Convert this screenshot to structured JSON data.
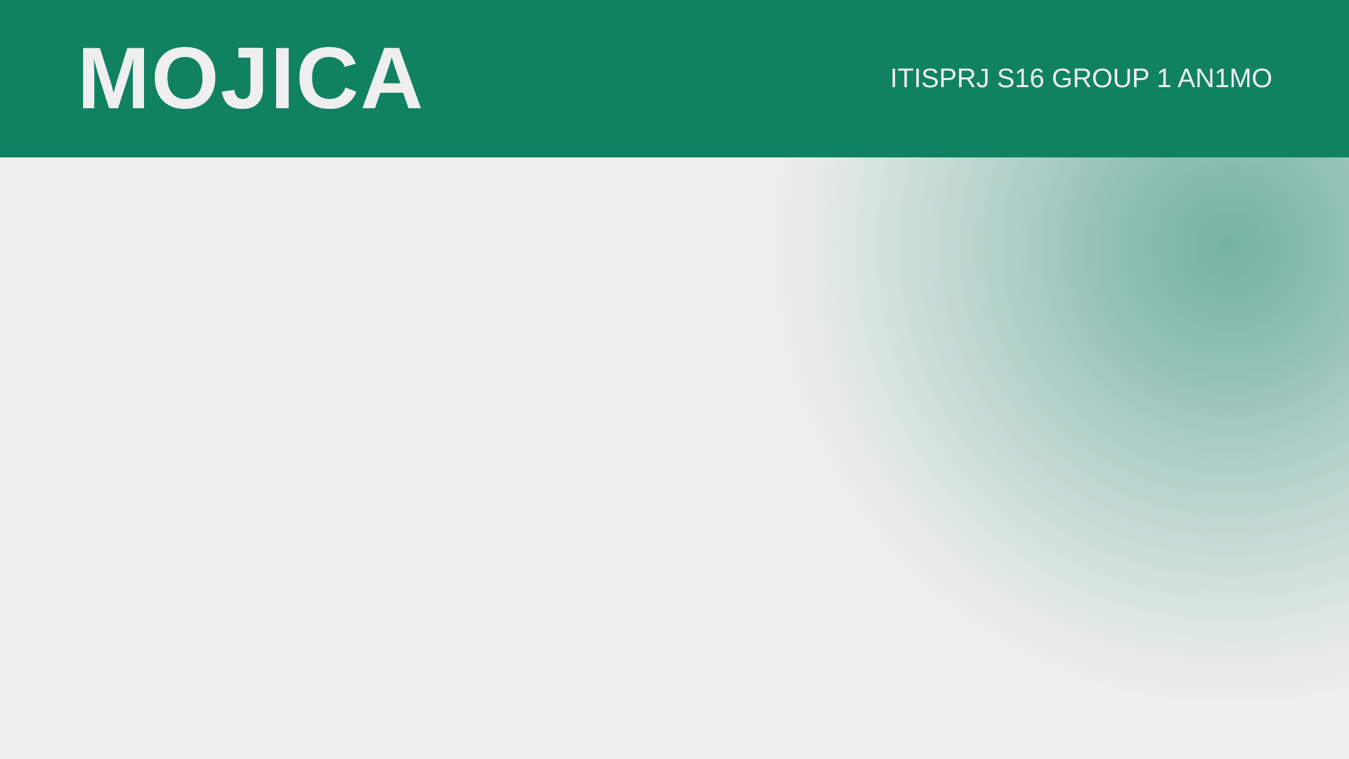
{
  "header": {
    "title": "MOJICA",
    "subtitle": "ITISPRJ S16 GROUP 1 AN1MO"
  },
  "colors": {
    "brand_green": "#108261",
    "background": "#efefef",
    "header_text": "#efefef"
  }
}
